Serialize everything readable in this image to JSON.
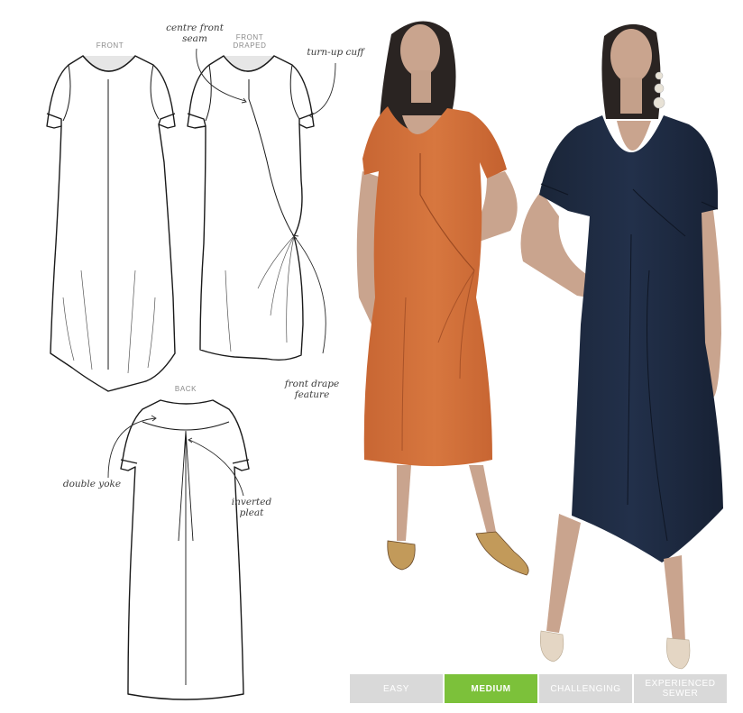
{
  "views": {
    "front": "FRONT",
    "front_draped_line1": "FRONT",
    "front_draped_line2": "DRAPED",
    "back": "BACK"
  },
  "annotations": {
    "centre_front_seam_line1": "centre front",
    "centre_front_seam_line2": "seam",
    "turn_up_cuff": "turn-up cuff",
    "front_drape_line1": "front drape",
    "front_drape_line2": "feature",
    "double_yoke": "double yoke",
    "inverted_pleat_line1": "inverted",
    "inverted_pleat_line2": "pleat"
  },
  "difficulty": {
    "levels": [
      {
        "label_line1": "EASY",
        "label_line2": ""
      },
      {
        "label_line1": "MEDIUM",
        "label_line2": ""
      },
      {
        "label_line1": "CHALLENGING",
        "label_line2": ""
      },
      {
        "label_line1": "EXPERIENCED",
        "label_line2": "SEWER"
      }
    ],
    "selected": "MEDIUM",
    "active_color": "#7cc13a",
    "inactive_color": "#d9d9d9"
  },
  "colors": {
    "orange_dress": "#d0703e",
    "navy_dress": "#1d2a40",
    "skin": "#c9a48e",
    "hair": "#2a2422"
  }
}
